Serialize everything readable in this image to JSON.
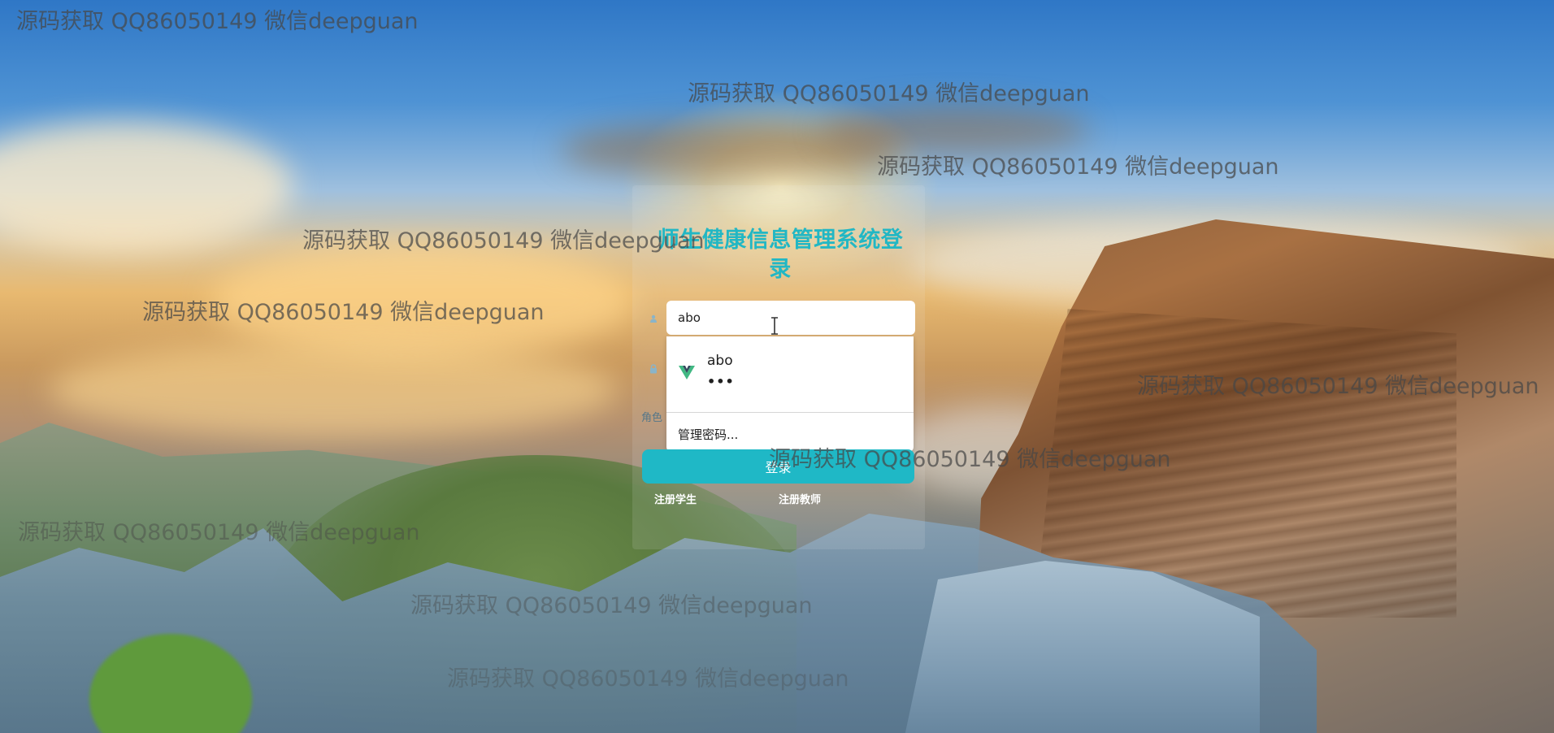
{
  "watermark_text": "源码获取 QQ86050149 微信deepguan",
  "login": {
    "title": "师生健康信息管理系统登录",
    "username_value": "abo",
    "role_label": "角色",
    "login_button": "登录",
    "register_student": "注册学生",
    "register_teacher": "注册教师"
  },
  "autocomplete": {
    "saved_username": "abo",
    "saved_password_mask": "•••",
    "manage_passwords": "管理密码..."
  },
  "colors": {
    "accent": "#1fb8c6",
    "title": "#22b7c4"
  },
  "icons": {
    "username_field": "user-icon",
    "password_field": "lock-icon",
    "saved_login": "vue-logo-icon",
    "mouse": "text-cursor-icon"
  }
}
